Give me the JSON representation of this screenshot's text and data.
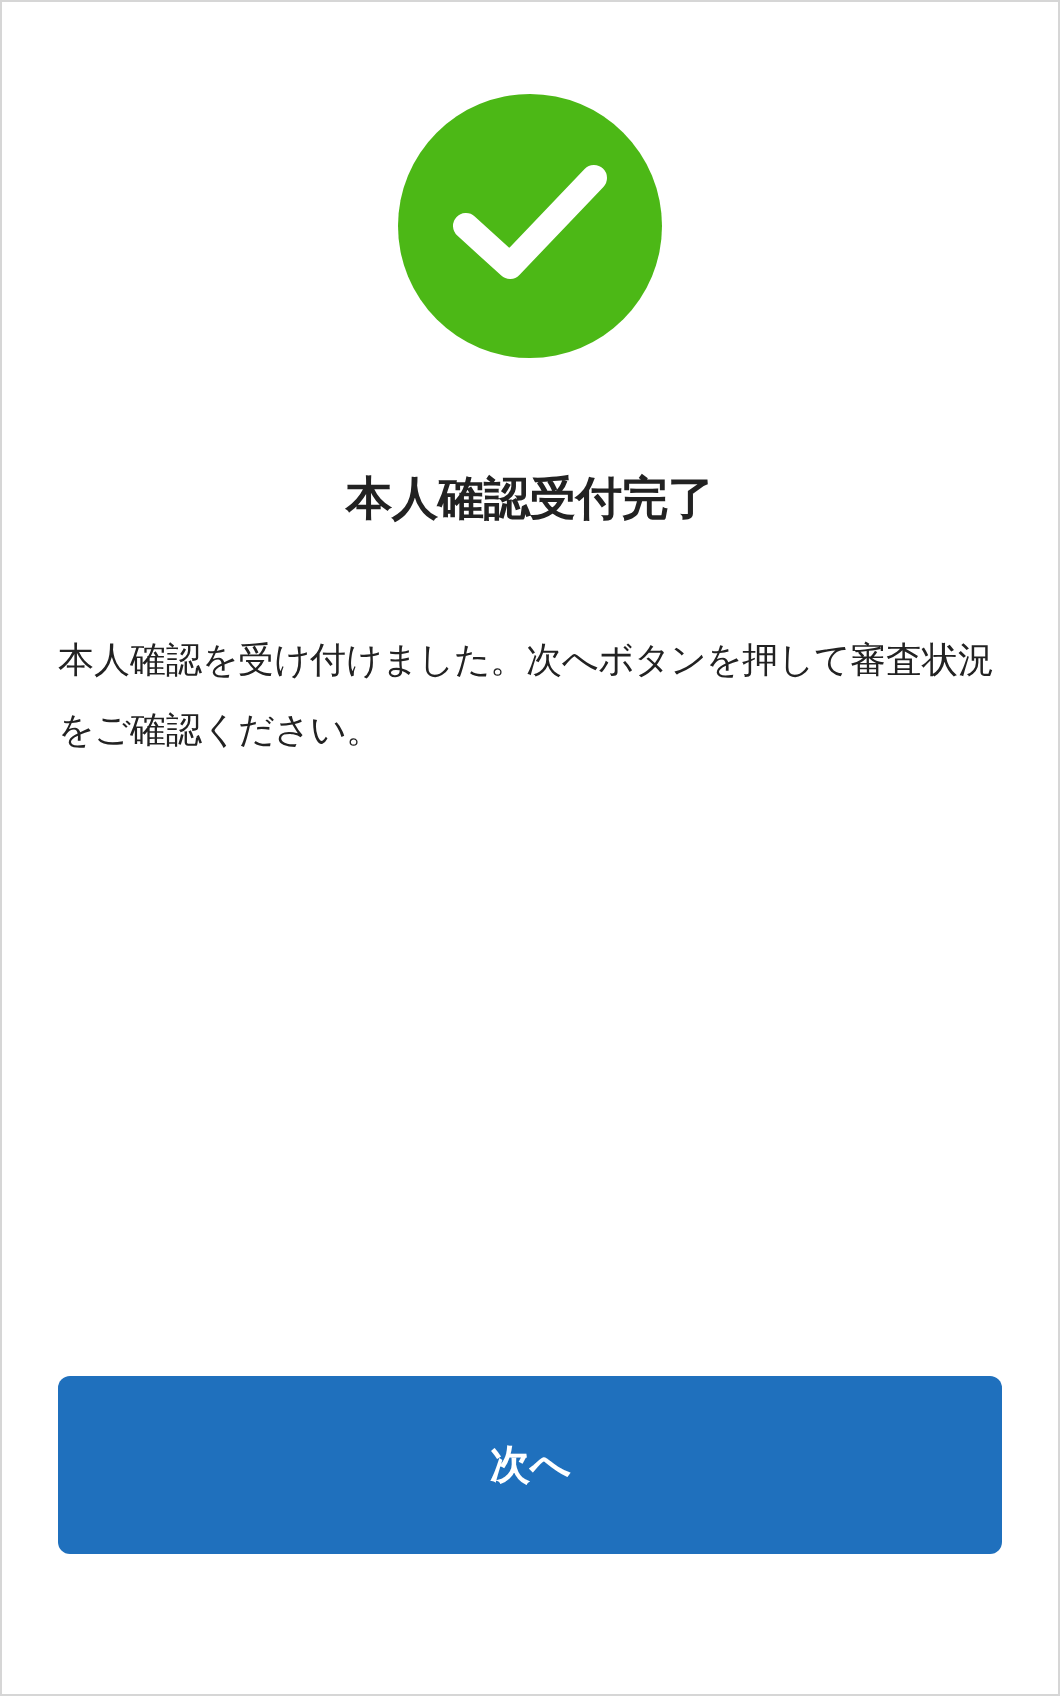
{
  "title": "本人確認受付完了",
  "message": "本人確認を受け付けました。次へボタンを押して審査状況をご確認ください。",
  "button": {
    "label": "次へ"
  }
}
